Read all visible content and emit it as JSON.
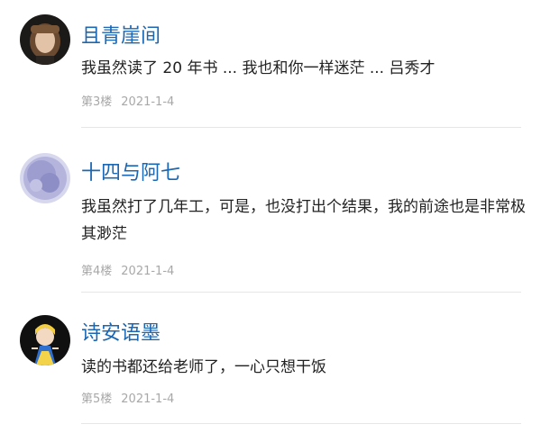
{
  "comments": [
    {
      "avatar_icon": "user-portrait-icon",
      "user": "且青崖间",
      "text": "我虽然读了 20 年书 ... 我也和你一样迷茫 ... 吕秀才",
      "floor": "第3楼",
      "date": "2021-1-4"
    },
    {
      "avatar_icon": "watercolor-avatar-icon",
      "user": "十四与阿七",
      "text": "我虽然打了几年工，可是，也没打出个结果，我的前途也是非常极其渺茫",
      "floor": "第4楼",
      "date": "2021-1-4"
    },
    {
      "avatar_icon": "cartoon-princess-avatar-icon",
      "user": "诗安语墨",
      "text": "读的书都还给老师了，一心只想干饭",
      "floor": "第5楼",
      "date": "2021-1-4"
    }
  ]
}
